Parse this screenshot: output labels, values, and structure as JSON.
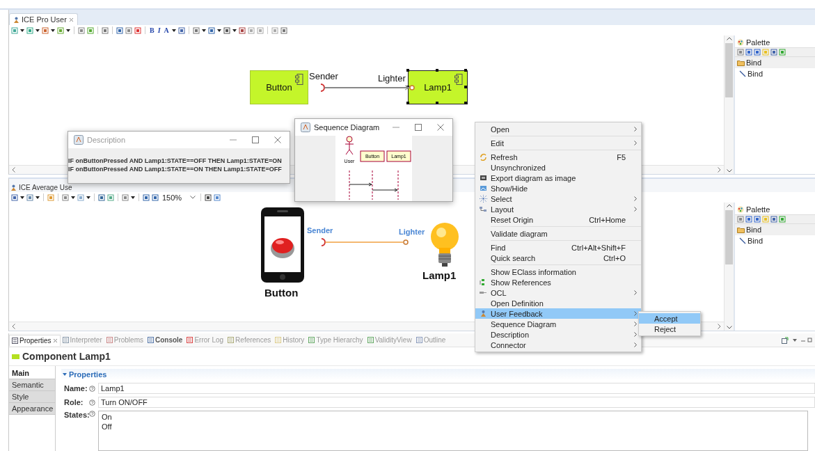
{
  "pro_editor": {
    "tab_title": "ICE Pro User",
    "toolbar_text": [
      "B",
      "I",
      "A"
    ],
    "components": [
      {
        "name": "Button",
        "selected": false
      },
      {
        "name": "Lamp1",
        "selected": true
      }
    ],
    "ports": [
      "Sender",
      "Lighter"
    ],
    "palette": {
      "title": "Palette",
      "drawers": [
        {
          "label": "Bind",
          "expanded": true,
          "entries": [
            "Bind"
          ]
        }
      ]
    }
  },
  "average_editor": {
    "tab_title": "ICE Average Use",
    "zoom": "150%",
    "device_label": "Button",
    "bulb_label": "Lamp1",
    "ports": [
      "Sender",
      "Lighter"
    ],
    "palette": {
      "title": "Palette",
      "drawers": [
        {
          "label": "Bind",
          "expanded": true,
          "entries": [
            "Bind"
          ]
        }
      ]
    }
  },
  "description_window": {
    "title": "Description",
    "lines": [
      "IF onButtonPressed AND Lamp1:STATE==OFF THEN Lamp1:STATE=ON",
      "IF onButtonPressed AND Lamp1:STATE==ON THEN Lamp1:STATE=OFF"
    ]
  },
  "sequence_window": {
    "title": "Sequence Diagram",
    "actor": "User",
    "participants": [
      "Button",
      "Lamp1"
    ]
  },
  "context_menu": {
    "groups": [
      [
        {
          "label": "Open",
          "has_submenu": true,
          "selected": false
        }
      ],
      [
        {
          "label": "Edit",
          "has_submenu": true,
          "selected": false
        }
      ],
      [
        {
          "label": "Refresh",
          "shortcut": "F5",
          "has_submenu": false,
          "selected": false
        },
        {
          "label": "Unsynchronized",
          "has_submenu": false,
          "selected": false
        },
        {
          "label": "Export diagram as image",
          "has_submenu": false,
          "selected": false
        },
        {
          "label": "Show/Hide",
          "has_submenu": false,
          "selected": false
        },
        {
          "label": "Select",
          "has_submenu": true,
          "selected": false
        },
        {
          "label": "Layout",
          "has_submenu": true,
          "selected": false
        },
        {
          "label": "Reset Origin",
          "shortcut": "Ctrl+Home",
          "has_submenu": false,
          "selected": false
        }
      ],
      [
        {
          "label": "Validate diagram",
          "has_submenu": false,
          "selected": false
        }
      ],
      [
        {
          "label": "Find",
          "shortcut": "Ctrl+Alt+Shift+F",
          "has_submenu": false,
          "selected": false
        },
        {
          "label": "Quick search",
          "shortcut": "Ctrl+O",
          "has_submenu": false,
          "selected": false
        }
      ],
      [
        {
          "label": "Show EClass information",
          "has_submenu": false,
          "selected": false
        },
        {
          "label": "Show References",
          "has_submenu": false,
          "selected": false
        },
        {
          "label": "OCL",
          "has_submenu": true,
          "selected": false
        },
        {
          "label": "Open Definition",
          "has_submenu": false,
          "selected": false
        },
        {
          "label": "User Feedback",
          "has_submenu": true,
          "selected": true
        },
        {
          "label": "Sequence Diagram",
          "has_submenu": true,
          "selected": false
        },
        {
          "label": "Description",
          "has_submenu": true,
          "selected": false
        },
        {
          "label": "Connector",
          "has_submenu": true,
          "selected": false
        }
      ]
    ]
  },
  "submenu": {
    "items": [
      {
        "label": "Accept",
        "selected": true
      },
      {
        "label": "Reject",
        "selected": false
      }
    ]
  },
  "properties_view": {
    "tabs": [
      {
        "label": "Properties",
        "selected": true,
        "emphasized": false
      },
      {
        "label": "Interpreter",
        "selected": false,
        "emphasized": false
      },
      {
        "label": "Problems",
        "selected": false,
        "emphasized": false
      },
      {
        "label": "Console",
        "selected": false,
        "emphasized": true
      },
      {
        "label": "Error Log",
        "selected": false,
        "emphasized": false
      },
      {
        "label": "References",
        "selected": false,
        "emphasized": false
      },
      {
        "label": "History",
        "selected": false,
        "emphasized": false
      },
      {
        "label": "Type Hierarchy",
        "selected": false,
        "emphasized": false
      },
      {
        "label": "ValidityView",
        "selected": false,
        "emphasized": false
      },
      {
        "label": "Outline",
        "selected": false,
        "emphasized": false
      }
    ],
    "title": "Component Lamp1",
    "side_tabs": [
      {
        "label": "Main",
        "selected": true
      },
      {
        "label": "Semantic",
        "selected": false
      },
      {
        "label": "Style",
        "selected": false
      },
      {
        "label": "Appearance",
        "selected": false
      }
    ],
    "section": "Properties",
    "fields": [
      {
        "label": "Name:",
        "value": "Lamp1"
      },
      {
        "label": "Role:",
        "value": "Turn ON/OFF"
      }
    ],
    "states": {
      "label": "States:",
      "items": [
        "On",
        "Off"
      ]
    }
  }
}
